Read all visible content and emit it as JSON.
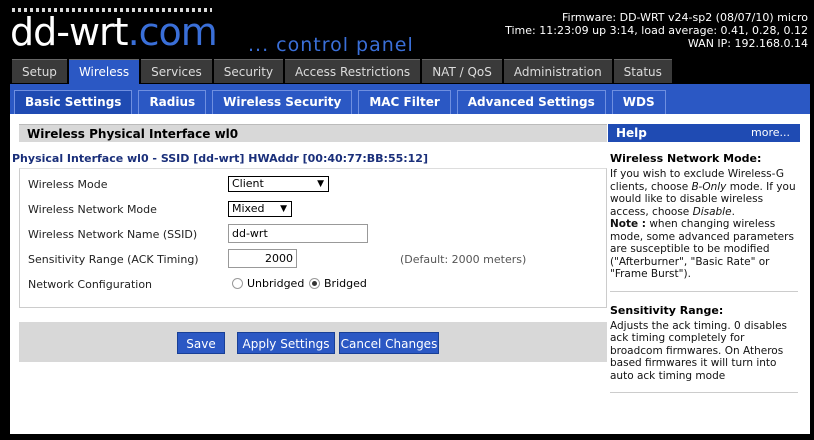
{
  "header": {
    "logo_main": "dd-wrt",
    "logo_suffix": ".com",
    "tagline": "... control panel",
    "firmware": "Firmware: DD-WRT v24-sp2 (08/07/10) micro",
    "time": "Time: 11:23:09 up 3:14, load average: 0.41, 0.28, 0.12",
    "wan_ip": "WAN IP: 192.168.0.14"
  },
  "main_tabs": [
    "Setup",
    "Wireless",
    "Services",
    "Security",
    "Access Restrictions",
    "NAT / QoS",
    "Administration",
    "Status"
  ],
  "sub_tabs": [
    "Basic Settings",
    "Radius",
    "Wireless Security",
    "MAC Filter",
    "Advanced Settings",
    "WDS"
  ],
  "section_title": "Wireless Physical Interface wl0",
  "interface_title": "Physical Interface wl0 - SSID [dd-wrt] HWAddr [00:40:77:BB:55:12]",
  "form": {
    "wireless_mode_label": "Wireless Mode",
    "wireless_mode_value": "Client",
    "network_mode_label": "Wireless Network Mode",
    "network_mode_value": "Mixed",
    "ssid_label": "Wireless Network Name (SSID)",
    "ssid_value": "dd-wrt",
    "sensitivity_label": "Sensitivity Range (ACK Timing)",
    "sensitivity_value": "2000",
    "sensitivity_hint": "(Default: 2000 meters)",
    "netconfig_label": "Network Configuration",
    "netconfig_option1": "Unbridged",
    "netconfig_option2": "Bridged"
  },
  "buttons": {
    "save": "Save",
    "apply": "Apply Settings",
    "cancel": "Cancel Changes"
  },
  "help": {
    "title": "Help",
    "more": "more...",
    "sect1_title": "Wireless Network Mode:",
    "sect1_body_a": "If you wish to exclude Wireless-G clients, choose ",
    "sect1_em1": "B-Only",
    "sect1_body_b": " mode. If you would like to disable wireless access, choose ",
    "sect1_em2": "Disable",
    "sect1_body_c": ".",
    "sect1_note_label": "Note :",
    "sect1_note": " when changing wireless mode, some advanced parameters are susceptible to be modified (\"Afterburner\", \"Basic Rate\" or \"Frame Burst\").",
    "sect2_title": "Sensitivity Range:",
    "sect2_body": "Adjusts the ack timing. 0 disables ack timing completely for broadcom firmwares. On Atheros based firmwares it will turn into auto ack timing mode"
  }
}
